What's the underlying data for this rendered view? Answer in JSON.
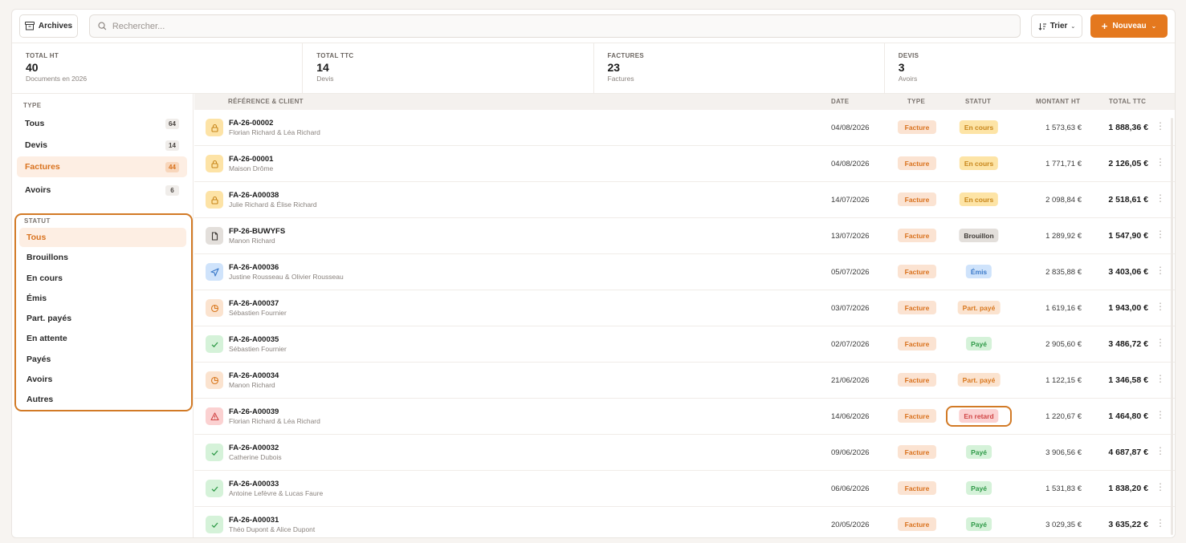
{
  "toolbar": {
    "archives_label": "Archives",
    "search_placeholder": "Rechercher...",
    "sort_label": "Trier",
    "new_label": "Nouveau"
  },
  "stats": [
    {
      "label": "TOTAL HT",
      "value": "40",
      "sub": "Documents en 2026"
    },
    {
      "label": "TOTAL TTC",
      "value": "14",
      "sub": "Devis"
    },
    {
      "label": "FACTURES",
      "value": "23",
      "sub": "Factures"
    },
    {
      "label": "DEVIS",
      "value": "3",
      "sub": "Avoirs"
    }
  ],
  "sidebar": {
    "type_title": "TYPE",
    "types": [
      {
        "label": "Tous",
        "count": "64"
      },
      {
        "label": "Devis",
        "count": "14"
      },
      {
        "label": "Factures",
        "count": "44"
      },
      {
        "label": "Avoirs",
        "count": "6"
      }
    ],
    "active_type": "Factures",
    "status_title": "STATUT",
    "statuses": [
      "Tous",
      "Brouillons",
      "En cours",
      "Émis",
      "Part. payés",
      "En attente",
      "Payés",
      "Avoirs",
      "Autres"
    ],
    "active_status": "Tous"
  },
  "table": {
    "headers": {
      "ref": "RÉFÉRENCE & CLIENT",
      "date": "DATE",
      "type": "TYPE",
      "status": "STATUT",
      "ht": "MONTANT HT",
      "ttc": "TOTAL TTC"
    },
    "rows": [
      {
        "icon": "lock",
        "ref": "FA-26-00002",
        "client": "Florian Richard & Léa Richard",
        "date": "04/08/2026",
        "type": "Facture",
        "status": "En cours",
        "status_kind": "encours",
        "ht": "1 573,63 €",
        "ttc": "1 888,36 €"
      },
      {
        "icon": "lock",
        "ref": "FA-26-00001",
        "client": "Maison Drôme",
        "date": "04/08/2026",
        "type": "Facture",
        "status": "En cours",
        "status_kind": "encours",
        "ht": "1 771,71 €",
        "ttc": "2 126,05 €"
      },
      {
        "icon": "lock",
        "ref": "FA-26-A00038",
        "client": "Julie Richard & Élise Richard",
        "date": "14/07/2026",
        "type": "Facture",
        "status": "En cours",
        "status_kind": "encours",
        "ht": "2 098,84 €",
        "ttc": "2 518,61 €"
      },
      {
        "icon": "file",
        "ref": "FP-26-BUWYFS",
        "client": "Manon Richard",
        "date": "13/07/2026",
        "type": "Facture",
        "status": "Brouillon",
        "status_kind": "brouillon",
        "ht": "1 289,92 €",
        "ttc": "1 547,90 €"
      },
      {
        "icon": "send",
        "ref": "FA-26-A00036",
        "client": "Justine Rousseau & Olivier Rousseau",
        "date": "05/07/2026",
        "type": "Facture",
        "status": "Émis",
        "status_kind": "emis",
        "ht": "2 835,88 €",
        "ttc": "3 403,06 €"
      },
      {
        "icon": "pie",
        "ref": "FA-26-A00037",
        "client": "Sébastien Fournier",
        "date": "03/07/2026",
        "type": "Facture",
        "status": "Part. payé",
        "status_kind": "part",
        "ht": "1 619,16 €",
        "ttc": "1 943,00 €"
      },
      {
        "icon": "check",
        "ref": "FA-26-A00035",
        "client": "Sébastien Fournier",
        "date": "02/07/2026",
        "type": "Facture",
        "status": "Payé",
        "status_kind": "paye",
        "ht": "2 905,60 €",
        "ttc": "3 486,72 €"
      },
      {
        "icon": "pie",
        "ref": "FA-26-A00034",
        "client": "Manon Richard",
        "date": "21/06/2026",
        "type": "Facture",
        "status": "Part. payé",
        "status_kind": "part",
        "ht": "1 122,15 €",
        "ttc": "1 346,58 €"
      },
      {
        "icon": "warning",
        "ref": "FA-26-A00039",
        "client": "Florian Richard & Léa Richard",
        "date": "14/06/2026",
        "type": "Facture",
        "status": "En retard",
        "status_kind": "retard",
        "ht": "1 220,67 €",
        "ttc": "1 464,80 €"
      },
      {
        "icon": "check",
        "ref": "FA-26-A00032",
        "client": "Catherine Dubois",
        "date": "09/06/2026",
        "type": "Facture",
        "status": "Payé",
        "status_kind": "paye",
        "ht": "3 906,56 €",
        "ttc": "4 687,87 €"
      },
      {
        "icon": "check",
        "ref": "FA-26-A00033",
        "client": "Antoine Lefèvre & Lucas Faure",
        "date": "06/06/2026",
        "type": "Facture",
        "status": "Payé",
        "status_kind": "paye",
        "ht": "1 531,83 €",
        "ttc": "1 838,20 €"
      },
      {
        "icon": "check",
        "ref": "FA-26-A00031",
        "client": "Théo Dupont & Alice Dupont",
        "date": "20/05/2026",
        "type": "Facture",
        "status": "Payé",
        "status_kind": "paye",
        "ht": "3 029,35 €",
        "ttc": "3 635,22 €"
      }
    ]
  },
  "colors": {
    "accent": "#e4781e",
    "highlight_ring": "#d27a26"
  }
}
